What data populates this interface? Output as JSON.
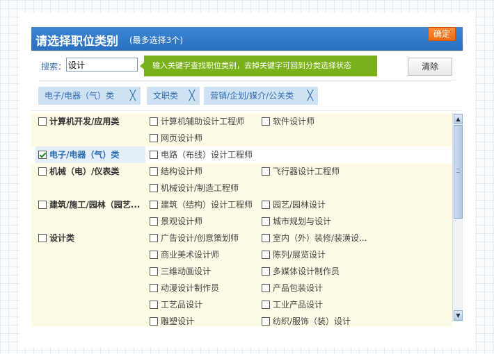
{
  "dialog": {
    "title": "请选择职位类别",
    "subtitle": "(最多选择3个)",
    "confirm_label": "确定"
  },
  "search": {
    "label": "搜索：",
    "value": "设计",
    "tip": "输入关键字查找职位类别，去掉关键字可回到分类选择状态",
    "clear_label": "清除"
  },
  "selected_tags": [
    {
      "label": "电子/电器（气）类"
    },
    {
      "label": "文职类"
    },
    {
      "label": "营销/企划/媒介/公关类"
    }
  ],
  "tag_remove_glyph": "╳",
  "groups": [
    {
      "name": "计算机开发/应用类",
      "checked": false,
      "children": [
        {
          "label": "计算机辅助设计工程师",
          "checked": false
        },
        {
          "label": "软件设计师",
          "checked": false
        },
        {
          "label": "网页设计师",
          "checked": false
        }
      ]
    },
    {
      "name": "电子/电器（气）类",
      "checked": true,
      "children": [
        {
          "label": "电路（布线）设计工程师",
          "checked": false
        }
      ]
    },
    {
      "name": "机械（电）/仪表类",
      "checked": false,
      "children": [
        {
          "label": "结构设计师",
          "checked": false
        },
        {
          "label": "飞行器设计工程师",
          "checked": false
        },
        {
          "label": "机械设计/制造工程师",
          "checked": false
        }
      ]
    },
    {
      "name": "建筑/施工/园林（园艺...",
      "checked": false,
      "children": [
        {
          "label": "建筑（结构）设计工程师",
          "checked": false
        },
        {
          "label": "园艺/园林设计",
          "checked": false
        },
        {
          "label": "景观设计师",
          "checked": false
        },
        {
          "label": "城市规划与设计",
          "checked": false
        }
      ]
    },
    {
      "name": "设计类",
      "checked": false,
      "children": [
        {
          "label": "广告设计/创意策划师",
          "checked": false
        },
        {
          "label": "室内（外）装修/装潢设...",
          "checked": false
        },
        {
          "label": "商业美术设计师",
          "checked": false
        },
        {
          "label": "陈列/展览设计",
          "checked": false
        },
        {
          "label": "三维动画设计",
          "checked": false
        },
        {
          "label": "多媒体设计制作员",
          "checked": false
        },
        {
          "label": "动漫设计制作员",
          "checked": false
        },
        {
          "label": "产品包装设计",
          "checked": false
        },
        {
          "label": "工艺品设计",
          "checked": false
        },
        {
          "label": "工业产品设计",
          "checked": false
        },
        {
          "label": "雕塑设计",
          "checked": false
        },
        {
          "label": "纺织/服饰（装）设计",
          "checked": false
        }
      ]
    }
  ],
  "scrollbar": {
    "up_glyph": "▲",
    "down_glyph": "▼"
  }
}
